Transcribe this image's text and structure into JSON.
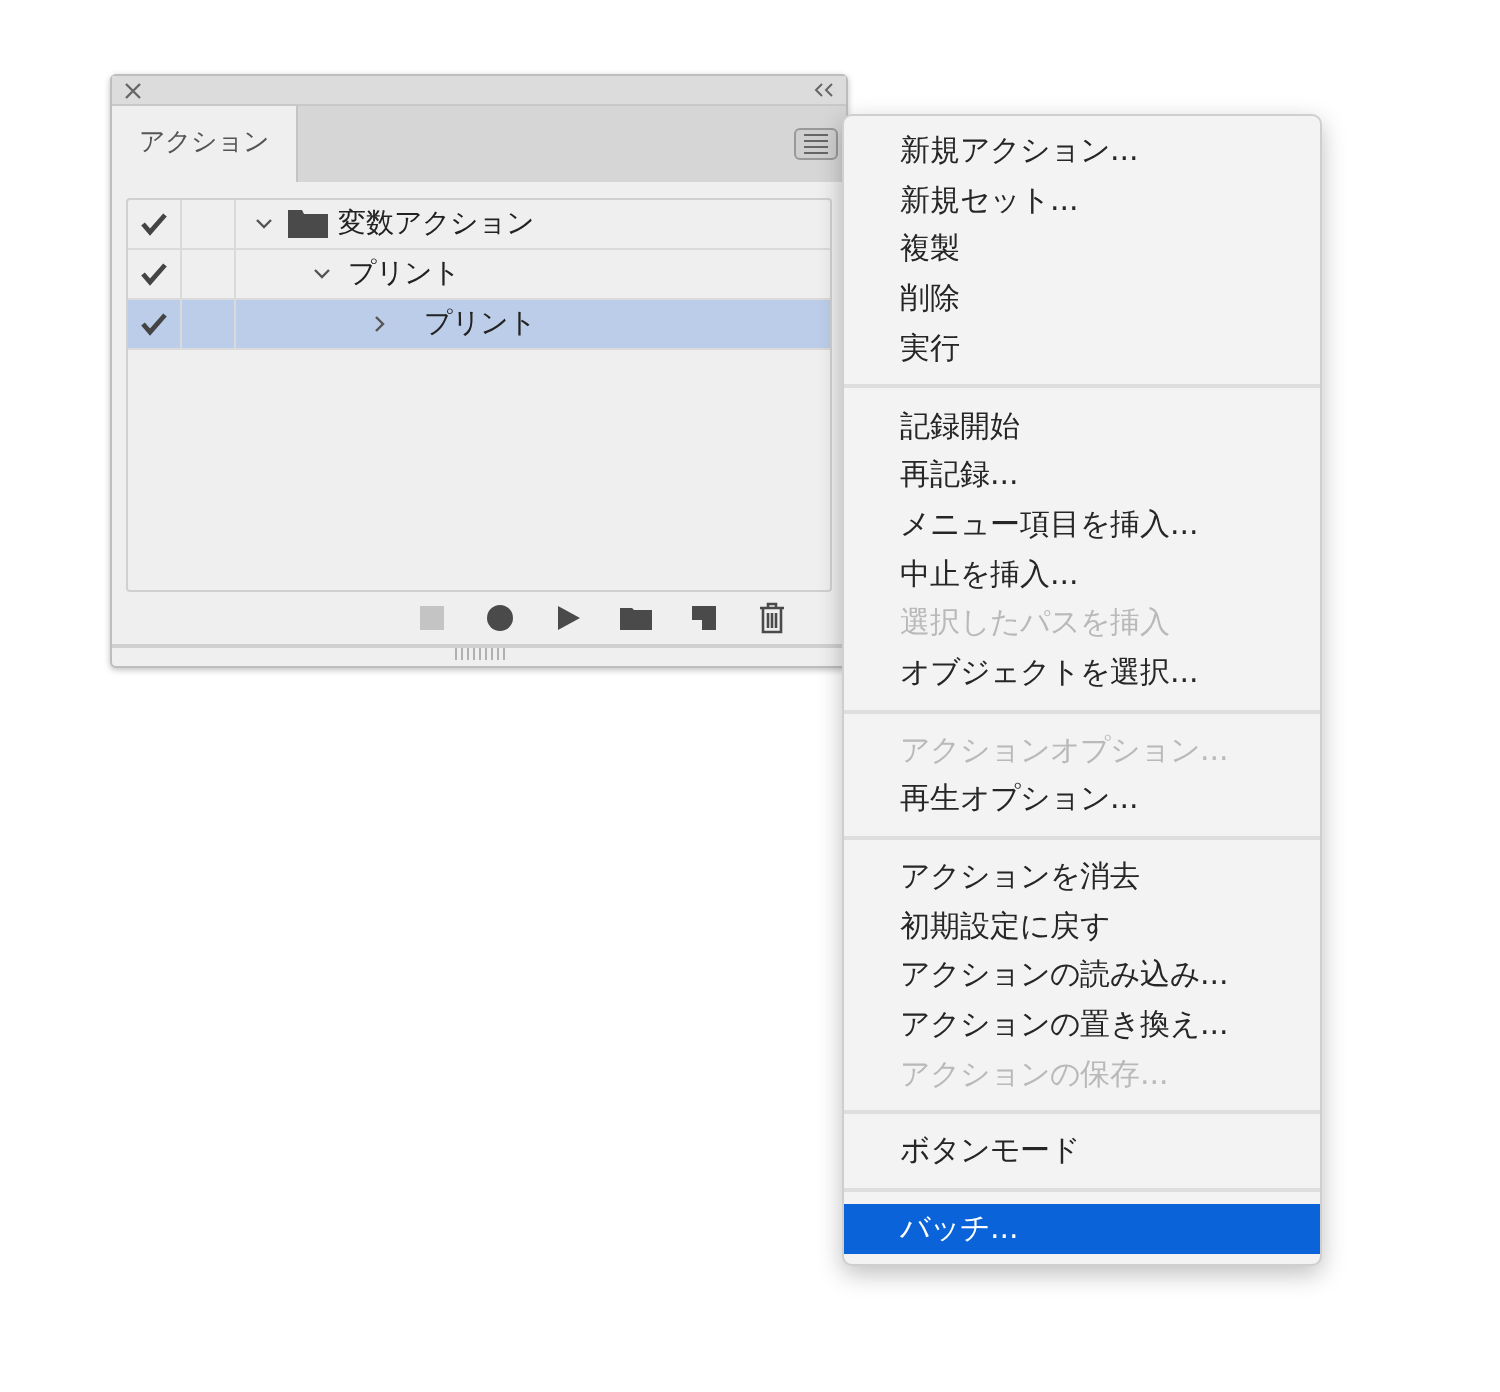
{
  "panel": {
    "tab": {
      "label": "アクション",
      "selected": true
    },
    "tree": [
      {
        "kind": "set",
        "label": "変数アクション",
        "checked": true,
        "expanded": true,
        "selected": false,
        "children": [
          {
            "kind": "action",
            "label": "プリント",
            "checked": true,
            "expanded": true,
            "selected": false,
            "children": [
              {
                "kind": "command",
                "label": "プリント",
                "checked": true,
                "expanded": false,
                "selected": true
              }
            ]
          }
        ]
      }
    ],
    "toolbar": [
      {
        "kind": "stop",
        "disabled": true
      },
      {
        "kind": "record",
        "disabled": false
      },
      {
        "kind": "play",
        "disabled": false
      },
      {
        "kind": "folder",
        "disabled": false
      },
      {
        "kind": "new",
        "disabled": false
      },
      {
        "kind": "trash",
        "disabled": false
      }
    ]
  },
  "menu": [
    [
      {
        "label": "新規アクション...",
        "disabled": false,
        "selected": false
      },
      {
        "label": "新規セット...",
        "disabled": false,
        "selected": false
      },
      {
        "label": "複製",
        "disabled": false,
        "selected": false
      },
      {
        "label": "削除",
        "disabled": false,
        "selected": false
      },
      {
        "label": "実行",
        "disabled": false,
        "selected": false
      }
    ],
    [
      {
        "label": "記録開始",
        "disabled": false,
        "selected": false
      },
      {
        "label": "再記録...",
        "disabled": false,
        "selected": false
      },
      {
        "label": "メニュー項目を挿入...",
        "disabled": false,
        "selected": false
      },
      {
        "label": "中止を挿入...",
        "disabled": false,
        "selected": false
      },
      {
        "label": "選択したパスを挿入",
        "disabled": true,
        "selected": false
      },
      {
        "label": "オブジェクトを選択...",
        "disabled": false,
        "selected": false
      }
    ],
    [
      {
        "label": "アクションオプション...",
        "disabled": true,
        "selected": false
      },
      {
        "label": "再生オプション...",
        "disabled": false,
        "selected": false
      }
    ],
    [
      {
        "label": "アクションを消去",
        "disabled": false,
        "selected": false
      },
      {
        "label": "初期設定に戻す",
        "disabled": false,
        "selected": false
      },
      {
        "label": "アクションの読み込み...",
        "disabled": false,
        "selected": false
      },
      {
        "label": "アクションの置き換え...",
        "disabled": false,
        "selected": false
      },
      {
        "label": "アクションの保存...",
        "disabled": true,
        "selected": false
      }
    ],
    [
      {
        "label": "ボタンモード",
        "disabled": false,
        "selected": false
      }
    ],
    [
      {
        "label": "バッチ...",
        "disabled": false,
        "selected": true
      }
    ]
  ]
}
